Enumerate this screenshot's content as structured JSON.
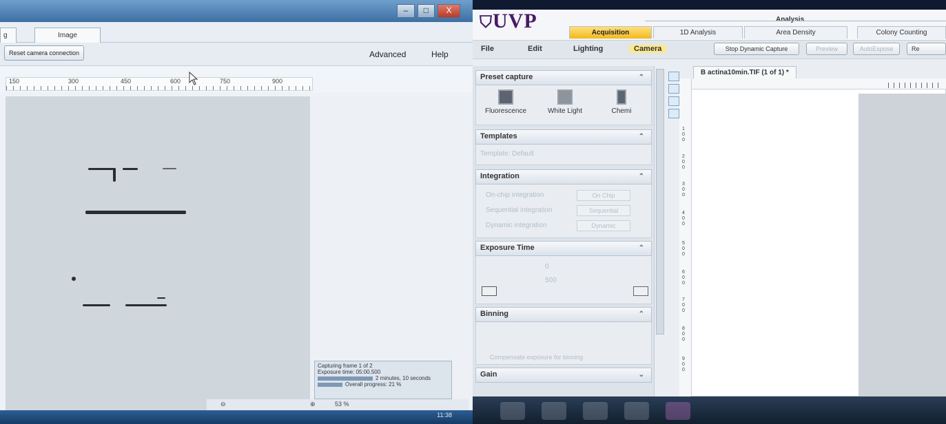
{
  "left_window": {
    "window_controls": [
      "–",
      "□",
      "X"
    ],
    "tabs": [
      "g",
      "Image"
    ],
    "toolbar": {
      "reset_button": "Reset camera connection",
      "menu": [
        "Advanced",
        "Help"
      ]
    },
    "ruler_ticks": [
      "150",
      "300",
      "450",
      "600",
      "750",
      "900"
    ],
    "panel_controls": "▾ ◁  ▷ ✕",
    "status": {
      "line1": "Capturing frame 1 of 2",
      "line2": "Exposure time: 05:00.500",
      "remaining": "2 minutes, 10 seconds",
      "overall": "Overall progress: 21 %",
      "zoom": "53 %"
    },
    "clock": "11:38"
  },
  "right_window": {
    "logo": "UVP",
    "analysis_label": "Analysis",
    "tabs": [
      "Acquisition",
      "1D Analysis",
      "Area Density",
      "Colony Counting"
    ],
    "menu": [
      "File",
      "Edit",
      "Lighting",
      "Camera"
    ],
    "buttons": [
      "Stop Dynamic Capture",
      "Preview",
      "AutoExpose",
      "Re"
    ],
    "sections": {
      "preset_capture": {
        "title": "Preset capture",
        "items": [
          "Fluorescence",
          "White Light",
          "Chemi"
        ]
      },
      "templates": {
        "title": "Templates",
        "field": "Template: Default"
      },
      "integration": {
        "title": "Integration",
        "rows": [
          {
            "label": "On-chip integration",
            "button": "On Chip"
          },
          {
            "label": "Sequential integration",
            "button": "Sequential"
          },
          {
            "label": "Dynamic integration",
            "button": "Dynamic"
          }
        ]
      },
      "exposure_time": {
        "title": "Exposure Time",
        "field1": "0",
        "field2": "500"
      },
      "binning": {
        "title": "Binning",
        "hint": "Compensate exposure for binning"
      },
      "gain": {
        "title": "Gain"
      }
    },
    "document_tab": "B actina10min.TIF (1 of 1) *",
    "vruler_labels": [
      "1 0 0",
      "2 0 0",
      "3 0 0",
      "4 0 0",
      "5 0 0",
      "6 0 0",
      "7 0 0",
      "8 0 0",
      "9 0 0"
    ]
  }
}
